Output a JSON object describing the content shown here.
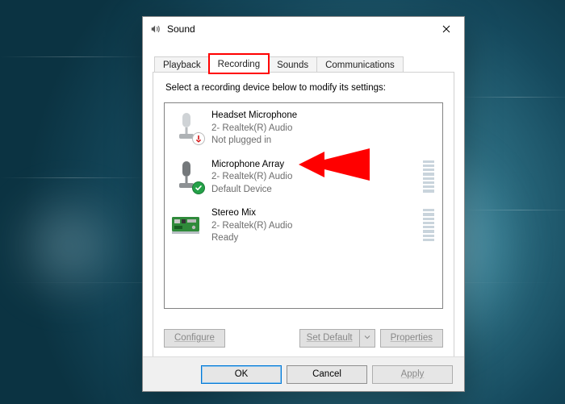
{
  "window": {
    "title": "Sound"
  },
  "tabs": {
    "playback": "Playback",
    "recording": "Recording",
    "sounds": "Sounds",
    "communications": "Communications",
    "selected": "recording"
  },
  "instruction": "Select a recording device below to modify its settings:",
  "devices": [
    {
      "name": "Headset Microphone",
      "driver": "2- Realtek(R) Audio",
      "status": "Not plugged in",
      "badge": "error",
      "meter": false,
      "icon": "headset-mic"
    },
    {
      "name": "Microphone Array",
      "driver": "2- Realtek(R) Audio",
      "status": "Default Device",
      "badge": "ok",
      "meter": true,
      "icon": "mic"
    },
    {
      "name": "Stereo Mix",
      "driver": "2- Realtek(R) Audio",
      "status": "Ready",
      "badge": null,
      "meter": true,
      "icon": "soundcard"
    }
  ],
  "buttons": {
    "configure": "Configure",
    "set_default": "Set Default",
    "properties": "Properties",
    "ok": "OK",
    "cancel": "Cancel",
    "apply": "Apply"
  }
}
